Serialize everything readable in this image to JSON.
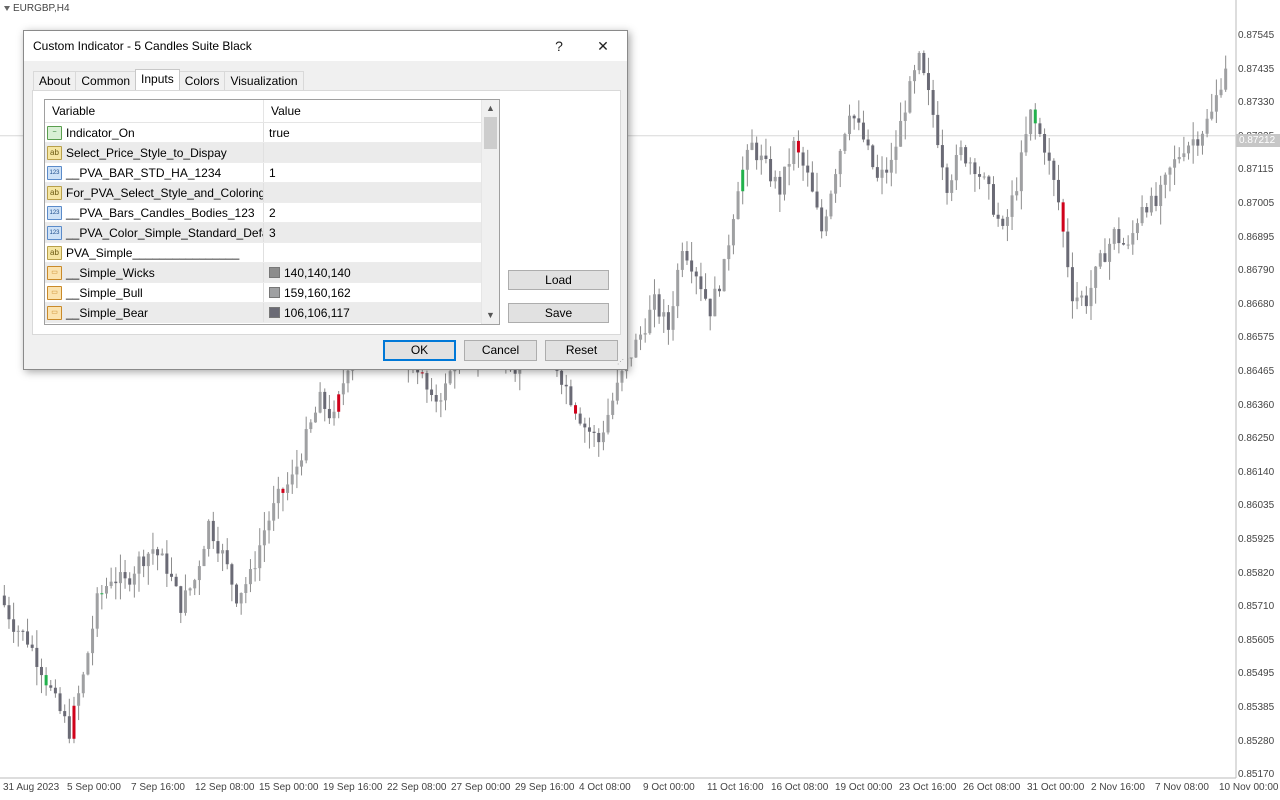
{
  "chart": {
    "symbol": "EURGBP,H4",
    "current_price": "0.87212",
    "price_axis": [
      "0.87545",
      "0.87435",
      "0.87330",
      "0.87225",
      "0.87115",
      "0.87005",
      "0.86895",
      "0.86790",
      "0.86680",
      "0.86575",
      "0.86465",
      "0.86360",
      "0.86250",
      "0.86140",
      "0.86035",
      "0.85925",
      "0.85820",
      "0.85710",
      "0.85605",
      "0.85495",
      "0.85385",
      "0.85280",
      "0.85170"
    ],
    "time_axis": [
      "31 Aug 2023",
      "5 Sep 00:00",
      "7 Sep 16:00",
      "12 Sep 08:00",
      "15 Sep 00:00",
      "19 Sep 16:00",
      "22 Sep 08:00",
      "27 Sep 00:00",
      "29 Sep 16:00",
      "4 Oct 08:00",
      "9 Oct 00:00",
      "11 Oct 16:00",
      "16 Oct 08:00",
      "19 Oct 00:00",
      "23 Oct 16:00",
      "26 Oct 08:00",
      "31 Oct 00:00",
      "2 Nov 16:00",
      "7 Nov 08:00",
      "10 Nov 00:00"
    ],
    "colors": {
      "wick": "#8c8c8c",
      "bull": "#9fa0a2",
      "bear": "#6a6a75",
      "highlight_bull": "#22b14c",
      "highlight_bear": "#d0021b"
    }
  },
  "chart_data": {
    "type": "candlestick",
    "ylim": [
      0.8517,
      0.8758
    ],
    "close_path": [
      0.8575,
      0.8566,
      0.8561,
      0.8552,
      0.8541,
      0.8532,
      0.8549,
      0.8573,
      0.8581,
      0.8579,
      0.8586,
      0.859,
      0.8584,
      0.8572,
      0.858,
      0.8598,
      0.8588,
      0.8575,
      0.8581,
      0.8596,
      0.8606,
      0.8612,
      0.8625,
      0.8637,
      0.8631,
      0.8649,
      0.8661,
      0.8662,
      0.8654,
      0.8651,
      0.8648,
      0.8636,
      0.8641,
      0.8655,
      0.8651,
      0.8658,
      0.8653,
      0.8648,
      0.8658,
      0.8652,
      0.8648,
      0.8638,
      0.8629,
      0.8624,
      0.8637,
      0.8649,
      0.8658,
      0.8668,
      0.866,
      0.8687,
      0.8678,
      0.8666,
      0.8679,
      0.8706,
      0.8718,
      0.8711,
      0.8704,
      0.8718,
      0.8708,
      0.8691,
      0.8711,
      0.873,
      0.872,
      0.8707,
      0.8712,
      0.8731,
      0.8745,
      0.8728,
      0.8706,
      0.8716,
      0.8712,
      0.8703,
      0.869,
      0.8706,
      0.8728,
      0.8718,
      0.87,
      0.8671,
      0.8669,
      0.8681,
      0.869,
      0.8685,
      0.87,
      0.8699,
      0.871,
      0.8718,
      0.8721,
      0.8728,
      0.8744
    ],
    "highlight": [
      {
        "i": 3,
        "dir": "bull"
      },
      {
        "i": 5,
        "dir": "bear"
      },
      {
        "i": 7,
        "dir": "bull"
      },
      {
        "i": 20,
        "dir": "bear"
      },
      {
        "i": 24,
        "dir": "bear"
      },
      {
        "i": 30,
        "dir": "bear"
      },
      {
        "i": 35,
        "dir": "bull"
      },
      {
        "i": 41,
        "dir": "bear"
      },
      {
        "i": 53,
        "dir": "bull"
      },
      {
        "i": 57,
        "dir": "bear"
      },
      {
        "i": 74,
        "dir": "bull"
      },
      {
        "i": 76,
        "dir": "bear"
      }
    ]
  },
  "dialog": {
    "title": "Custom Indicator - 5 Candles Suite Black",
    "help": "?",
    "close": "✕",
    "tabs": [
      "About",
      "Common",
      "Inputs",
      "Colors",
      "Visualization"
    ],
    "columns": {
      "variable": "Variable",
      "value": "Value"
    },
    "rows": [
      {
        "icon": "bool",
        "variable": "Indicator_On",
        "value": "true"
      },
      {
        "icon": "str",
        "variable": "Select_Price_Style_to_Dispay",
        "value": ""
      },
      {
        "icon": "int",
        "variable": "__PVA_BAR_STD_HA_1234",
        "value": "1"
      },
      {
        "icon": "str",
        "variable": "For_PVA_Select_Style_and_Coloring",
        "value": ""
      },
      {
        "icon": "int",
        "variable": "__PVA_Bars_Candles_Bodies_123",
        "value": "2"
      },
      {
        "icon": "int",
        "variable": "__PVA_Color_Simple_Standard_Defau...",
        "value": "3"
      },
      {
        "icon": "str",
        "variable": "PVA_Simple________________",
        "value": ""
      },
      {
        "icon": "color",
        "variable": "__Simple_Wicks",
        "value": "140,140,140",
        "swatch": "#8c8c8c"
      },
      {
        "icon": "color",
        "variable": "__Simple_Bull",
        "value": "159,160,162",
        "swatch": "#9fa0a2"
      },
      {
        "icon": "color",
        "variable": "__Simple_Bear",
        "value": "106,106,117",
        "swatch": "#6a6a75"
      }
    ],
    "icon_labels": {
      "bool": "~",
      "str": "ab",
      "int": "123",
      "color": "▭"
    },
    "buttons": {
      "load": "Load",
      "save": "Save",
      "ok": "OK",
      "cancel": "Cancel",
      "reset": "Reset"
    }
  }
}
